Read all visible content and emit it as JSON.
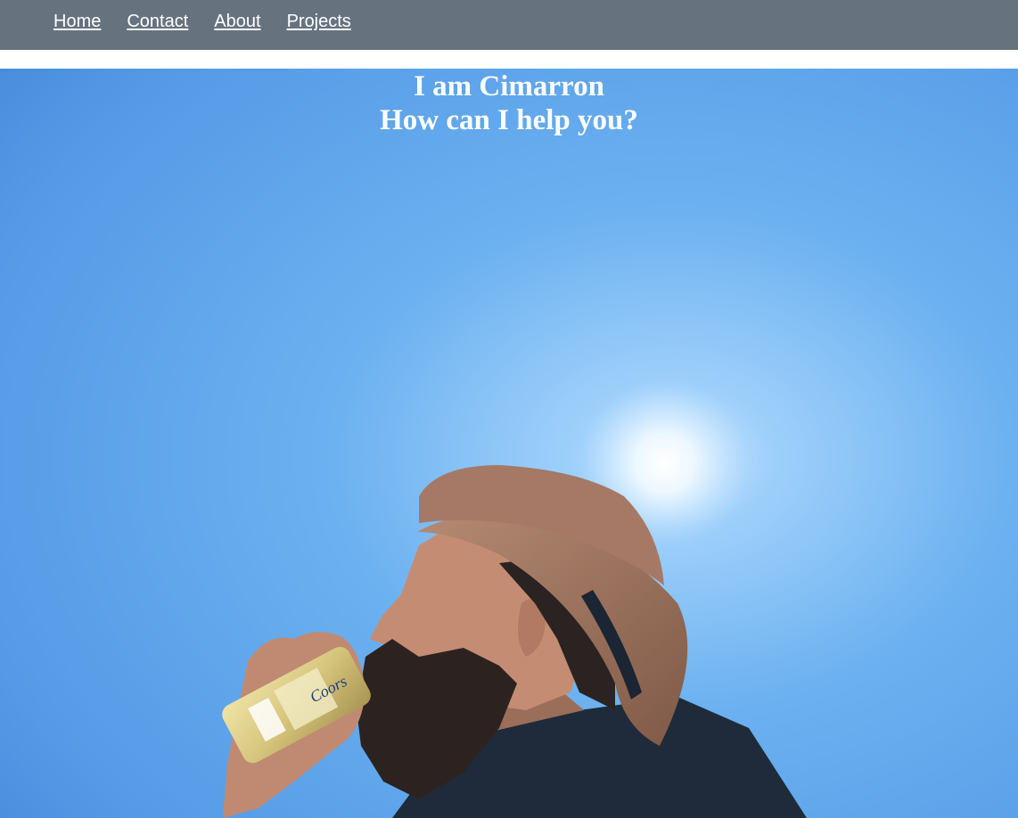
{
  "nav": {
    "items": [
      {
        "label": "Home"
      },
      {
        "label": "Contact"
      },
      {
        "label": "About"
      },
      {
        "label": "Projects"
      }
    ]
  },
  "hero": {
    "line1": "I am Cimarron",
    "line2": "How can I help you?",
    "photo_description": "man in straw fedora drinking from a can against a blue sky with sun glare",
    "sky_color": "#4d90dc"
  },
  "colors": {
    "navbar_bg": "#66737f",
    "nav_text": "#ffffff",
    "heading_text": "#ffffff"
  }
}
